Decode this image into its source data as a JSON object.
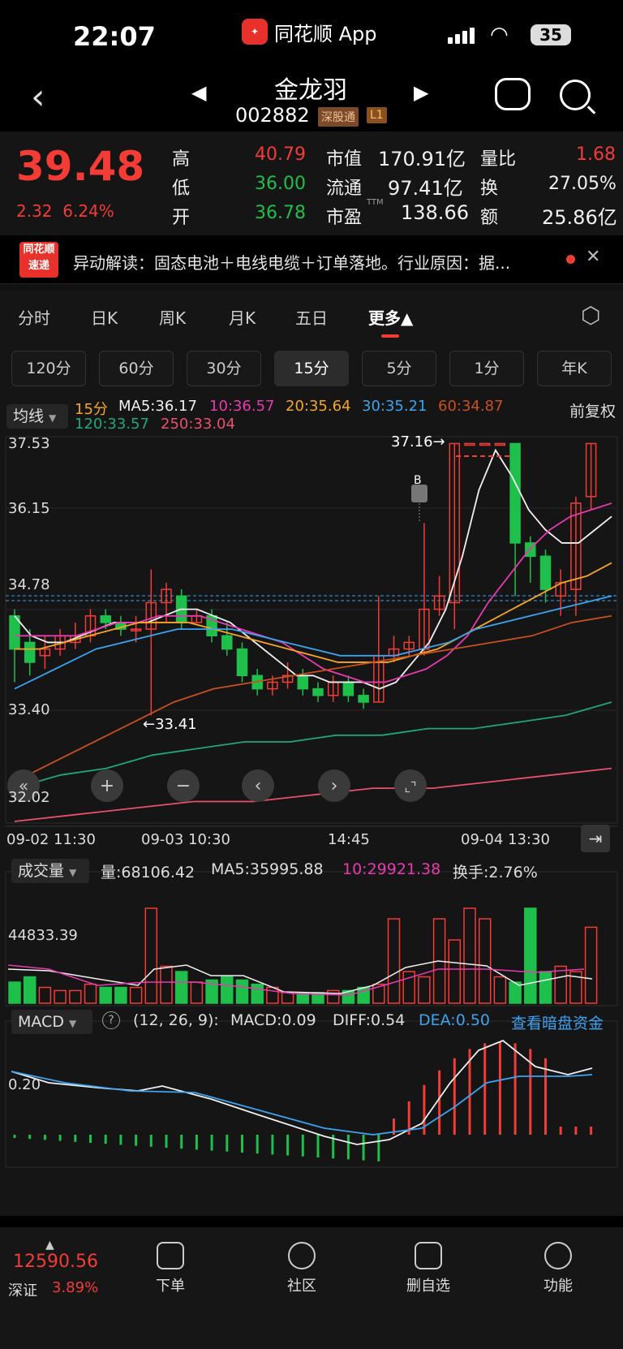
{
  "status": {
    "time": "22:07",
    "app": "同花顺 App",
    "battery": "35"
  },
  "header": {
    "name": "金龙羽",
    "code": "002882",
    "tag1": "深股通",
    "tag2": "L1"
  },
  "quote": {
    "price": "39.48",
    "change": "2.32",
    "pct": "6.24%",
    "high_label": "高",
    "high": "40.79",
    "low_label": "低",
    "low": "36.00",
    "open_label": "开",
    "open": "36.78",
    "mcap_label": "市值",
    "mcap": "170.91亿",
    "float_label": "流通",
    "float": "97.41亿",
    "pe_label": "市盈",
    "pe_sup": "TTM",
    "pe": "138.66",
    "vr_label": "量比",
    "vr": "1.68",
    "turn_label": "换",
    "turn": "27.05%",
    "amt_label": "额",
    "amt": "25.86亿"
  },
  "news": {
    "logo1": "同花顺",
    "logo2": "速递",
    "text": "异动解读：固态电池＋电线电缆＋订单落地。行业原因：据..."
  },
  "tabs": [
    "分时",
    "日K",
    "周K",
    "月K",
    "五日",
    "更多▲"
  ],
  "periods": [
    "120分",
    "60分",
    "30分",
    "15分",
    "5分",
    "1分",
    "年K"
  ],
  "ma": {
    "selector": "均线",
    "period": "15分",
    "ma5": "MA5:36.17",
    "ma10": "10:36.57",
    "ma20": "20:35.64",
    "ma30": "30:35.21",
    "ma60": "60:34.87",
    "ma120": "120:33.57",
    "ma250": "250:33.04",
    "adj": "前复权"
  },
  "axis": {
    "y1": "37.53",
    "y2": "36.15",
    "y3": "34.78",
    "y4": "33.40",
    "y5": "32.02",
    "maxlabel": "37.16→",
    "minlabel": "←33.41",
    "b": "B",
    "x1": "09-02 11:30",
    "x2": "09-03 10:30",
    "x3": "14:45",
    "x4": "09-04 13:30"
  },
  "volume": {
    "selector": "成交量",
    "vol": "量:68106.42",
    "ma5": "MA5:35995.88",
    "ma10": "10:29921.38",
    "turn": "换手:2.76%",
    "ylabel": "44833.39"
  },
  "macd": {
    "selector": "MACD",
    "params": "(12, 26, 9):",
    "macd": "MACD:0.09",
    "diff": "DIFF:0.54",
    "dea": "DEA:0.50",
    "link": "查看暗盘资金",
    "ylabel": "0.20"
  },
  "bottom": {
    "index": "12590.56",
    "index_name": "深证",
    "index_pct": "3.89%",
    "items": [
      "下单",
      "社区",
      "删自选",
      "功能"
    ]
  },
  "colors": {
    "up": "#f23c35",
    "down": "#1fbf4b",
    "ma5": "#f0f0f0",
    "ma10": "#e83ab0",
    "ma20": "#f5a623",
    "ma30": "#3ba3f0",
    "ma60": "#c8501e",
    "ma120": "#1fa77a",
    "ma250": "#e8506e"
  }
}
